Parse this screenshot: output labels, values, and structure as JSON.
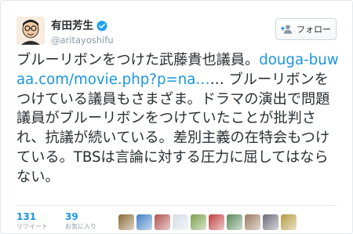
{
  "user": {
    "display_name": "有田芳生",
    "handle": "@aritayoshifu",
    "verified_icon": "verified-badge-icon",
    "avatar_icon": "avatar-caricature"
  },
  "follow_button": {
    "label": "フォロー",
    "icon": "add-user-icon"
  },
  "tweet": {
    "text_before_link": "ブルーリボンをつけた武藤貴也議員。",
    "link_text": "douga-buwaa.com/movie.php?p=na…",
    "text_after_link": "… ブルーリボンをつけている議員もさまざま。ドラマの演出で問題議員がブルーリボンをつけていたことが批判され、抗議が続いている。差別主義の在特会もつけている。TBSは言論に対する圧力に屈してはならない。"
  },
  "stats": {
    "retweets_count": "131",
    "retweets_label": "リツイート",
    "likes_count": "39",
    "likes_label": "お気に入り"
  },
  "colors": {
    "link": "#1b95e0",
    "text": "#292f33",
    "muted": "#8899a6",
    "border": "#e1e8ed",
    "verified": "#1da1f2"
  },
  "liker_avatars": [
    "#8a6a3a",
    "#3f7fc4",
    "#b05050",
    "#d5dde6",
    "#7aa04a",
    "#c04040",
    "#5a8a5a",
    "#9a7a60",
    "#6a6a78",
    "#b59a40"
  ]
}
